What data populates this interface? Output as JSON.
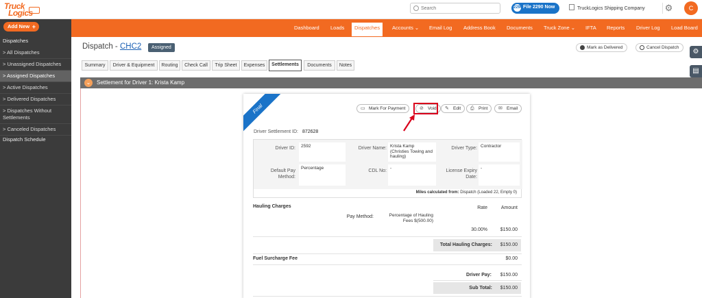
{
  "app": {
    "logo_line1": "Truck",
    "logo_line2": "Logics"
  },
  "topbar": {
    "search_placeholder": "Search",
    "file_button": "File 2290 Now",
    "file_icon": "2290",
    "company": "TruckLogics Shipping Company",
    "avatar_initial": "C"
  },
  "sidebar": {
    "add_new": "Add New",
    "add_icon": "+",
    "heading": "Dispatches",
    "items": [
      {
        "label": "> All Dispatches"
      },
      {
        "label": "> Unassigned Dispatches"
      },
      {
        "label": "> Assigned Dispatches",
        "active": true
      },
      {
        "label": "> Active Dispatches"
      },
      {
        "label": "> Delivered Dispatches"
      },
      {
        "label": "> Dispatches Without Settlements"
      },
      {
        "label": "> Canceled Dispatches"
      }
    ],
    "schedule": "Dispatch Schedule"
  },
  "nav": [
    {
      "label": "Dashboard"
    },
    {
      "label": "Loads"
    },
    {
      "label": "Dispatches",
      "active": true
    },
    {
      "label": "Accounts ⌄"
    },
    {
      "label": "Email Log"
    },
    {
      "label": "Address Book"
    },
    {
      "label": "Documents"
    },
    {
      "label": "Truck Zone ⌄"
    },
    {
      "label": "IFTA"
    },
    {
      "label": "Reports"
    },
    {
      "label": "Driver Log"
    },
    {
      "label": "Load Board"
    }
  ],
  "header": {
    "title_prefix": "Dispatch - ",
    "dispatch_no": "CHC2",
    "status": "Assigned",
    "mark_delivered": "Mark as Delivered",
    "cancel_dispatch": "Cancel Dispatch"
  },
  "tabs": [
    {
      "label": "Summary"
    },
    {
      "label": "Driver & Equipment"
    },
    {
      "label": "Routing"
    },
    {
      "label": "Check Call"
    },
    {
      "label": "Trip Sheet"
    },
    {
      "label": "Expenses"
    },
    {
      "label": "Settlements",
      "active": true
    },
    {
      "label": "Documents"
    },
    {
      "label": "Notes"
    }
  ],
  "section": {
    "title": "Settlement for Driver 1: Krista Kamp",
    "toggle_icon": "⌄"
  },
  "card": {
    "ribbon": "Final",
    "actions": {
      "mark_payment": "Mark For Payment",
      "void": "Void",
      "edit": "Edit",
      "print": "Print",
      "email": "Email"
    },
    "settlement_id_label": "Driver Settlement ID:",
    "settlement_id": "872628",
    "driver": {
      "id_label": "Driver ID:",
      "id": "2592",
      "name_label": "Driver Name:",
      "name": "Krista Kamp (Christies Towing and hauling)",
      "type_label": "Driver Type:",
      "type": "Contractor",
      "pay_method_label": "Default Pay Method:",
      "pay_method": "Percentage",
      "cdl_label": "CDL No:",
      "cdl": "-",
      "license_label": "License Expiry Date:",
      "license": "-"
    },
    "miles_label": "Miles calculated from:",
    "miles_value": "Dispatch (Loaded 22, Empty 0)",
    "hauling": {
      "title": "Hauling Charges",
      "rate_header": "Rate",
      "amount_header": "Amount",
      "pay_method_label": "Pay Method:",
      "pay_method_value": "Percentage of Hauling Fees $(500.00)",
      "rate": "30.00%",
      "amount": "$150.00",
      "total_label": "Total Hauling Charges:",
      "total": "$150.00"
    },
    "fuel": {
      "title": "Fuel Surcharge Fee",
      "amount": "$0.00"
    },
    "driver_pay_label": "Driver Pay:",
    "driver_pay": "$150.00",
    "subtotal_label": "Sub Total:",
    "subtotal": "$150.00"
  },
  "colors": {
    "brand": "#f26a21",
    "sidebar": "#3b3b3b",
    "primary": "#1a73c8",
    "highlight": "#d9001b"
  },
  "icons": [
    "search-icon",
    "gear-icon",
    "plus-icon",
    "building-icon",
    "check-circle-icon",
    "cancel-icon",
    "chevron-down-icon",
    "money-icon",
    "void-icon",
    "edit-icon",
    "print-icon",
    "email-icon",
    "settings-tab-icon",
    "document-tab-icon",
    "red-arrow-annotation"
  ]
}
